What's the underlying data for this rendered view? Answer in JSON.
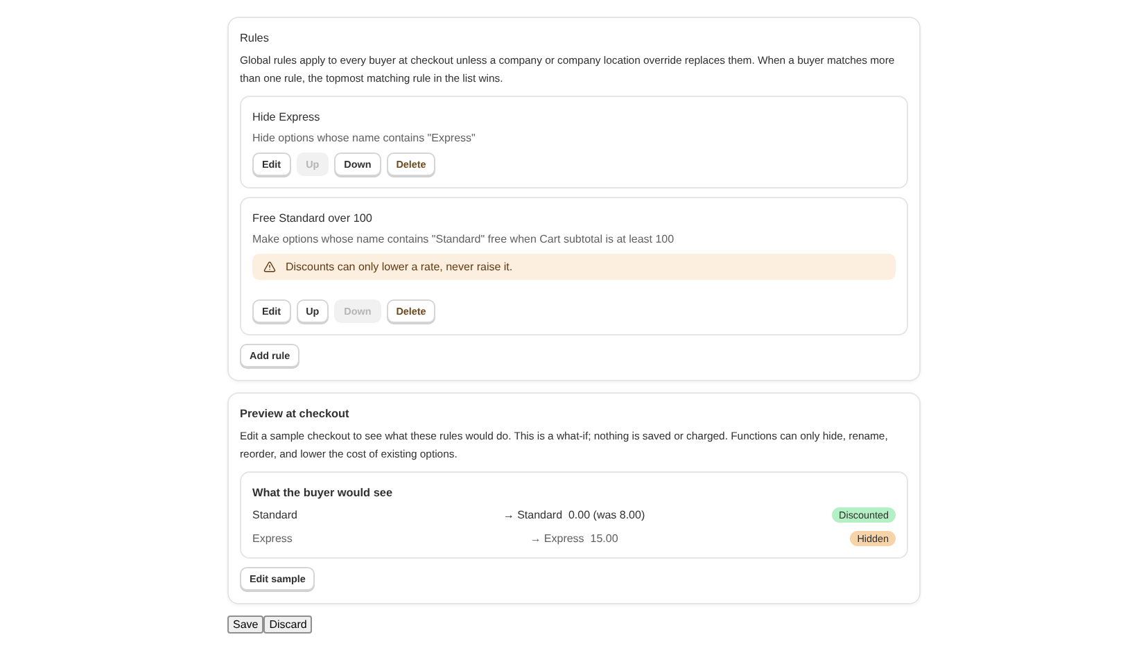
{
  "rules_section": {
    "title": "Rules",
    "description": "Global rules apply to every buyer at checkout unless a company or company location override replaces them. When a buyer matches more than one rule, the topmost matching rule in the list wins.",
    "rules": [
      {
        "name": "Hide Express",
        "summary": "Hide options whose name contains \"Express\"",
        "buttons": [
          {
            "label": "Edit",
            "disabled": false,
            "kind": "normal"
          },
          {
            "label": "Up",
            "disabled": true,
            "kind": "normal"
          },
          {
            "label": "Down",
            "disabled": false,
            "kind": "normal"
          },
          {
            "label": "Delete",
            "disabled": false,
            "kind": "danger"
          }
        ]
      },
      {
        "name": "Free Standard over 100",
        "summary": "Make options whose name contains \"Standard\" free when Cart subtotal is at least 100",
        "warning": "Discounts can only lower a rate, never raise it.",
        "buttons": [
          {
            "label": "Edit",
            "disabled": false,
            "kind": "normal"
          },
          {
            "label": "Up",
            "disabled": false,
            "kind": "normal"
          },
          {
            "label": "Down",
            "disabled": true,
            "kind": "normal"
          },
          {
            "label": "Delete",
            "disabled": false,
            "kind": "danger"
          }
        ]
      }
    ],
    "add_button": "Add rule"
  },
  "preview_section": {
    "title": "Preview at checkout",
    "description": "Edit a sample checkout to see what these rules would do. This is a what-if; nothing is saved or charged. Functions can only hide, rename, reorder, and lower the cost of existing options.",
    "result_title": "What the buyer would see",
    "rows": [
      {
        "option": "Standard",
        "arrow": "→",
        "result": "Standard  0.00 (was 8.00)",
        "badge": "Discounted",
        "kind": "discounted"
      },
      {
        "option": "Express",
        "arrow": "→",
        "result": "Express  15.00",
        "badge": "Hidden",
        "kind": "hidden"
      }
    ],
    "edit_button": "Edit sample"
  },
  "footer_buttons": [
    "Save",
    "Discard"
  ]
}
